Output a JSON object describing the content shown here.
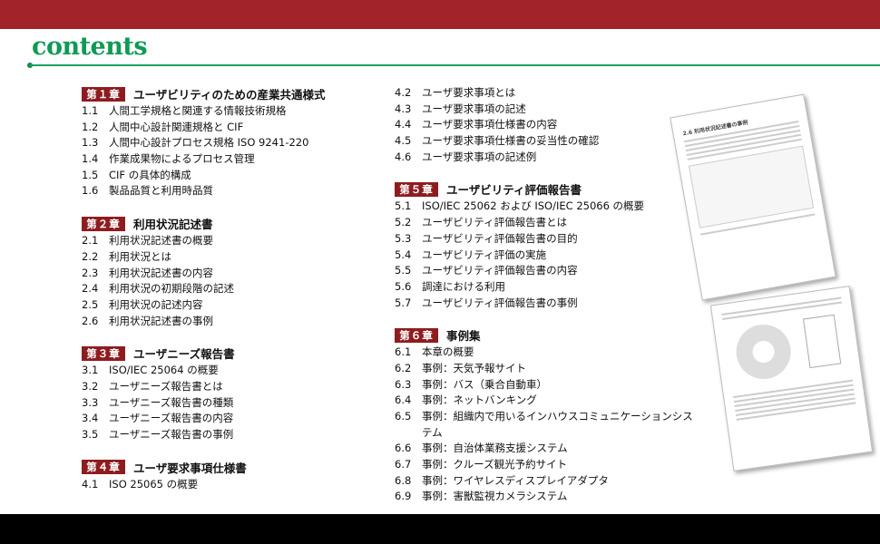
{
  "header": {
    "title": "contents"
  },
  "chapters": [
    {
      "badge": "第１章",
      "title": "ユーザビリティのための産業共通様式",
      "items": [
        {
          "n": "1.1",
          "t": "人間工学規格と関連する情報技術規格"
        },
        {
          "n": "1.2",
          "t": "人間中心設計関連規格と CIF"
        },
        {
          "n": "1.3",
          "t": "人間中心設計プロセス規格 ISO 9241-220"
        },
        {
          "n": "1.4",
          "t": "作業成果物によるプロセス管理"
        },
        {
          "n": "1.5",
          "t": "CIF の具体的構成"
        },
        {
          "n": "1.6",
          "t": "製品品質と利用時品質"
        }
      ]
    },
    {
      "badge": "第２章",
      "title": "利用状況記述書",
      "items": [
        {
          "n": "2.1",
          "t": "利用状況記述書の概要"
        },
        {
          "n": "2.2",
          "t": "利用状況とは"
        },
        {
          "n": "2.3",
          "t": "利用状況記述書の内容"
        },
        {
          "n": "2.4",
          "t": "利用状況の初期段階の記述"
        },
        {
          "n": "2.5",
          "t": "利用状況の記述内容"
        },
        {
          "n": "2.6",
          "t": "利用状況記述書の事例"
        }
      ]
    },
    {
      "badge": "第３章",
      "title": "ユーザニーズ報告書",
      "items": [
        {
          "n": "3.1",
          "t": "ISO/IEC 25064 の概要"
        },
        {
          "n": "3.2",
          "t": "ユーザニーズ報告書とは"
        },
        {
          "n": "3.3",
          "t": "ユーザニーズ報告書の種類"
        },
        {
          "n": "3.4",
          "t": "ユーザニーズ報告書の内容"
        },
        {
          "n": "3.5",
          "t": "ユーザニーズ報告書の事例"
        }
      ]
    },
    {
      "badge": "第４章",
      "title": "ユーザ要求事項仕様書",
      "items": [
        {
          "n": "4.1",
          "t": "ISO 25065 の概要"
        },
        {
          "n": "4.2",
          "t": "ユーザ要求事項とは"
        },
        {
          "n": "4.3",
          "t": "ユーザ要求事項の記述"
        },
        {
          "n": "4.4",
          "t": "ユーザ要求事項仕様書の内容"
        },
        {
          "n": "4.5",
          "t": "ユーザ要求事項仕様書の妥当性の確認"
        },
        {
          "n": "4.6",
          "t": "ユーザ要求事項の記述例"
        }
      ]
    },
    {
      "badge": "第５章",
      "title": "ユーザビリティ評価報告書",
      "items": [
        {
          "n": "5.1",
          "t": "ISO/IEC 25062 および ISO/IEC 25066 の概要"
        },
        {
          "n": "5.2",
          "t": "ユーザビリティ評価報告書とは"
        },
        {
          "n": "5.3",
          "t": "ユーザビリティ評価報告書の目的"
        },
        {
          "n": "5.4",
          "t": "ユーザビリティ評価の実施"
        },
        {
          "n": "5.5",
          "t": "ユーザビリティ評価報告書の内容"
        },
        {
          "n": "5.6",
          "t": "調達における利用"
        },
        {
          "n": "5.7",
          "t": "ユーザビリティ評価報告書の事例"
        }
      ]
    },
    {
      "badge": "第６章",
      "title": "事例集",
      "items": [
        {
          "n": "6.1",
          "t": "本章の概要"
        },
        {
          "n": "6.2",
          "t": "事例：天気予報サイト"
        },
        {
          "n": "6.3",
          "t": "事例：バス（乗合自動車）"
        },
        {
          "n": "6.4",
          "t": "事例：ネットバンキング"
        },
        {
          "n": "6.5",
          "t": "事例：組織内で用いるインハウスコミュニケーションシス",
          "t2": "テム"
        },
        {
          "n": "6.6",
          "t": "事例：自治体業務支援システム"
        },
        {
          "n": "6.7",
          "t": "事例：クルーズ観光予約サイト"
        },
        {
          "n": "6.8",
          "t": "事例：ワイヤレスディスプレイアダプタ"
        },
        {
          "n": "6.9",
          "t": "事例：害獣監視カメラシステム"
        }
      ]
    }
  ],
  "preview": {
    "page_heading": "2.6 利用状況記述書の事例"
  },
  "colors": {
    "top_bar": "#a3232a",
    "accent_green": "#0f9a55",
    "badge": "#8e1c1f"
  }
}
